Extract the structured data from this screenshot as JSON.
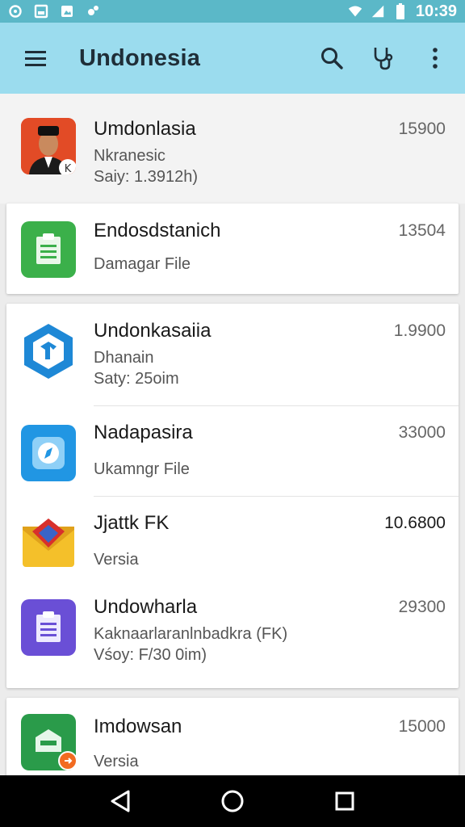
{
  "status_bar": {
    "time": "10:39",
    "icons": [
      "sync-icon",
      "sd-card-icon",
      "photo-icon",
      "bug-icon",
      "wifi-icon",
      "signal-icon",
      "battery-icon"
    ]
  },
  "app_bar": {
    "title": "Undonesia",
    "actions": [
      "search-icon",
      "stethoscope-icon",
      "more-vert-icon"
    ],
    "color": "#9bdcee"
  },
  "items": [
    {
      "title": "Umdonlasia",
      "sub1": "Nkranesic",
      "sub2": "Saiy: 1.3912h)",
      "num": "15900",
      "icon": "portrait-avatar",
      "color": "#d9442a"
    },
    {
      "title": "Endosdstanich",
      "sub1": "Damagar File",
      "sub2": "",
      "num": "13504",
      "icon": "clipboard-icon",
      "color": "#3bb04a"
    },
    {
      "title": "Undonkasaiia",
      "sub1": "Dhanain",
      "sub2": "Saty: 25oim",
      "num": "1.9900",
      "icon": "hexagon-icon",
      "color": "#1e88d6"
    },
    {
      "title": "Nadapasira",
      "sub1": "Ukamngr File",
      "sub2": "",
      "num": "33000",
      "icon": "compass-icon",
      "color": "#2196e3"
    },
    {
      "title": "Jjattk FK",
      "sub1": "Versia",
      "sub2": "",
      "num": "10.6800",
      "icon": "envelope-icon",
      "color": "#f4c02a"
    },
    {
      "title": "Undowharla",
      "sub1": "Kaknaarlaranlnbadkra (FK)",
      "sub2": "Vśoy: F/30 0im)",
      "num": "29300",
      "icon": "clipboard-icon",
      "color": "#6a4fd6"
    },
    {
      "title": "Imdowsan",
      "sub1": "Versia",
      "sub2": "",
      "num": "15000",
      "icon": "inbox-icon",
      "color": "#2a9b4a"
    }
  ],
  "nav_bar": {
    "buttons": [
      "back-icon",
      "home-icon",
      "recents-icon"
    ]
  }
}
